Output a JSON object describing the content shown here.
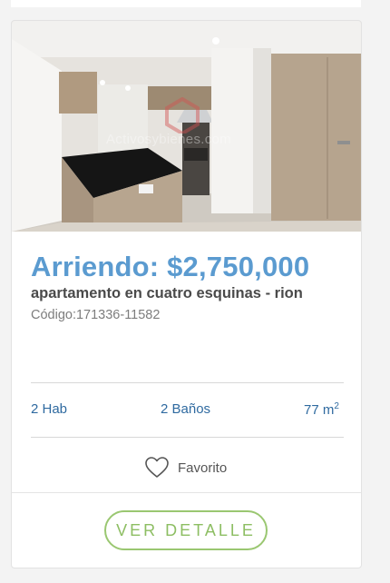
{
  "listing": {
    "price": "Arriendo: $2,750,000",
    "title": "apartamento en cuatro esquinas - rion",
    "code": "Código:171336-11582",
    "watermark": "Activosybienes.com",
    "features": {
      "rooms": "2 Hab",
      "baths": "2 Baños",
      "area": "77 m",
      "area_unit_sup": "2"
    },
    "favorite_label": "Favorito",
    "detail_button": "VER DETALLE"
  },
  "colors": {
    "price": "#5b9bd0",
    "features": "#2f6aa0",
    "button_border": "#9ac771"
  },
  "icons": {
    "favorite": "heart-outline-icon"
  }
}
